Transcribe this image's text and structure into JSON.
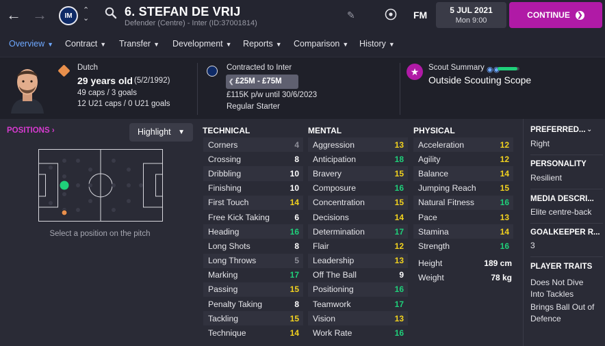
{
  "topbar": {
    "player_name": "6. STEFAN DE VRIJ",
    "player_subtitle": "Defender (Centre) - Inter (ID:37001814)",
    "fm_logo": "FM",
    "date": "5 JUL 2021",
    "time": "Mon 9:00",
    "continue_label": "CONTINUE"
  },
  "tabs": [
    {
      "label": "Overview",
      "active": true
    },
    {
      "label": "Contract"
    },
    {
      "label": "Transfer"
    },
    {
      "label": "Development"
    },
    {
      "label": "Reports"
    },
    {
      "label": "Comparison"
    },
    {
      "label": "History"
    }
  ],
  "info": {
    "nationality": "Dutch",
    "age": "29 years old",
    "dob": "(5/2/1992)",
    "caps": "49 caps / 3 goals",
    "u21_caps": "12 U21 caps / 0 U21 goals",
    "contract_title": "Contracted to Inter",
    "value_range": "£25M - £75M",
    "wage": "£115K p/w until 30/6/2023",
    "squad_status": "Regular Starter",
    "scout_title": "Scout Summary",
    "scout_value": "Outside Scouting Scope",
    "scout_knowledge": 0.9
  },
  "positions": {
    "title": "POSITIONS",
    "highlight_label": "Highlight",
    "hint": "Select a position on the pitch"
  },
  "colors": {
    "accent": "#b01aa6",
    "green": "#1fd07a",
    "yellow": "#f2d21e",
    "white": "#ffffff",
    "grey": "#8e8f99"
  },
  "technical": {
    "title": "TECHNICAL",
    "rows": [
      {
        "name": "Corners",
        "value": "4"
      },
      {
        "name": "Crossing",
        "value": "8"
      },
      {
        "name": "Dribbling",
        "value": "10"
      },
      {
        "name": "Finishing",
        "value": "10"
      },
      {
        "name": "First Touch",
        "value": "14"
      },
      {
        "name": "Free Kick Taking",
        "value": "6"
      },
      {
        "name": "Heading",
        "value": "16"
      },
      {
        "name": "Long Shots",
        "value": "8"
      },
      {
        "name": "Long Throws",
        "value": "5"
      },
      {
        "name": "Marking",
        "value": "17"
      },
      {
        "name": "Passing",
        "value": "15"
      },
      {
        "name": "Penalty Taking",
        "value": "8"
      },
      {
        "name": "Tackling",
        "value": "15"
      },
      {
        "name": "Technique",
        "value": "14"
      }
    ]
  },
  "mental": {
    "title": "MENTAL",
    "rows": [
      {
        "name": "Aggression",
        "value": "13"
      },
      {
        "name": "Anticipation",
        "value": "18"
      },
      {
        "name": "Bravery",
        "value": "15"
      },
      {
        "name": "Composure",
        "value": "16"
      },
      {
        "name": "Concentration",
        "value": "15"
      },
      {
        "name": "Decisions",
        "value": "14"
      },
      {
        "name": "Determination",
        "value": "17"
      },
      {
        "name": "Flair",
        "value": "12"
      },
      {
        "name": "Leadership",
        "value": "13"
      },
      {
        "name": "Off The Ball",
        "value": "9"
      },
      {
        "name": "Positioning",
        "value": "16"
      },
      {
        "name": "Teamwork",
        "value": "17"
      },
      {
        "name": "Vision",
        "value": "13"
      },
      {
        "name": "Work Rate",
        "value": "16"
      }
    ]
  },
  "physical": {
    "title": "PHYSICAL",
    "rows": [
      {
        "name": "Acceleration",
        "value": "12"
      },
      {
        "name": "Agility",
        "value": "12"
      },
      {
        "name": "Balance",
        "value": "14"
      },
      {
        "name": "Jumping Reach",
        "value": "15"
      },
      {
        "name": "Natural Fitness",
        "value": "16"
      },
      {
        "name": "Pace",
        "value": "13"
      },
      {
        "name": "Stamina",
        "value": "14"
      },
      {
        "name": "Strength",
        "value": "16"
      }
    ],
    "height_label": "Height",
    "height_value": "189 cm",
    "weight_label": "Weight",
    "weight_value": "78 kg"
  },
  "side": {
    "preferred_foot_title": "PREFERRED...",
    "preferred_foot": "Right",
    "personality_title": "PERSONALITY",
    "personality": "Resilient",
    "media_title": "MEDIA DESCRI...",
    "media": "Elite centre-back",
    "gk_title": "GOALKEEPER R...",
    "gk_value": "3",
    "traits_title": "PLAYER TRAITS",
    "trait_1_line_1": "Does Not Dive",
    "trait_1_line_2": "Into Tackles",
    "trait_2_line_1": "Brings Ball Out of",
    "trait_2_line_2": "Defence"
  }
}
